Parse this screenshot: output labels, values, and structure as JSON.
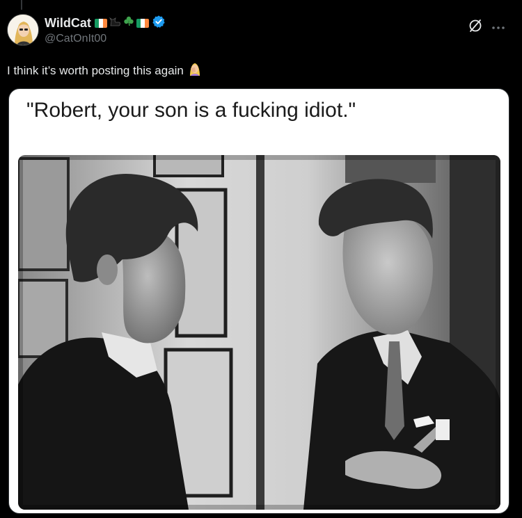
{
  "author": {
    "display_name": "WildCat",
    "handle": "@CatOnIt00",
    "badges": [
      "ireland-flag",
      "black-cat-emoji",
      "shamrock-emoji",
      "ireland-flag"
    ],
    "verified": true
  },
  "tweet": {
    "text": "I think it’s worth posting this again",
    "emoji": "🤦‍♀️"
  },
  "media": {
    "caption": "\"Robert, your son is a fucking idiot.\""
  },
  "icons": {
    "more": "more-options-icon",
    "grok": "grok-icon"
  },
  "colors": {
    "background": "#000000",
    "text": "#e7e9ea",
    "secondary_text": "#71767b",
    "verified_blue": "#1d9bf0",
    "flag_green": "#169b62",
    "flag_orange": "#ff883e"
  }
}
